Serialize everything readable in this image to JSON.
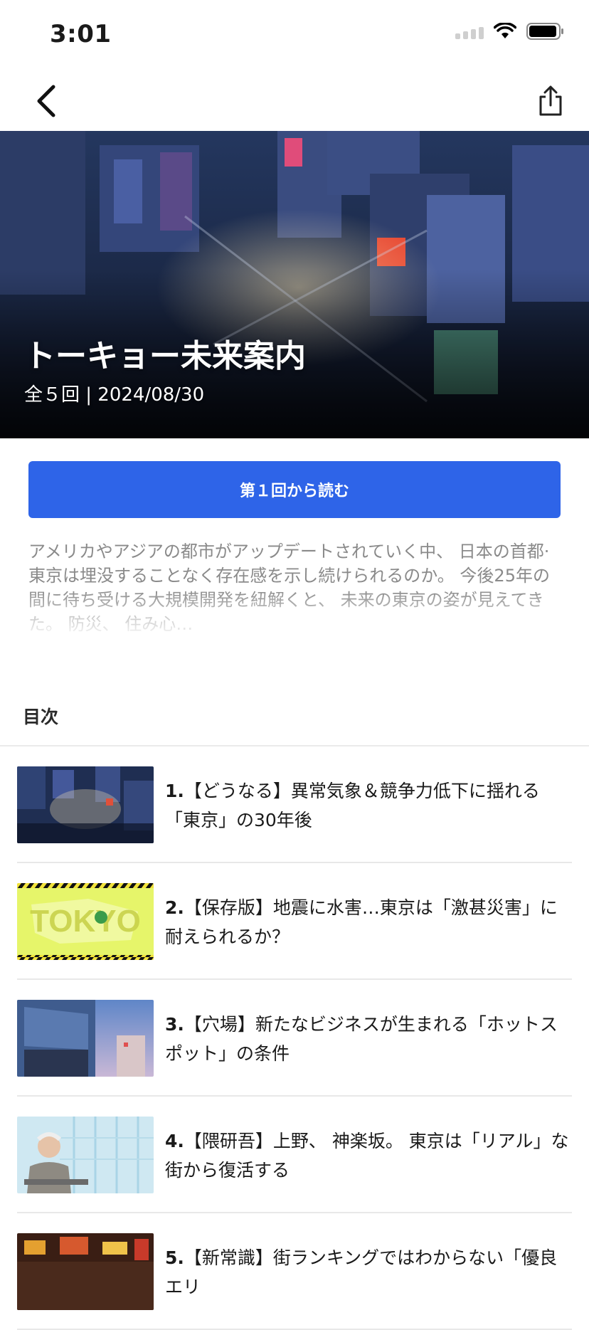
{
  "status_bar": {
    "time": "3:01"
  },
  "hero": {
    "title": "トーキョー未来案内",
    "meta": "全５回 | 2024/08/30"
  },
  "read_button": "第１回から読む",
  "description": "アメリカやアジアの都市がアップデートされていく中、 日本の首都·東京は埋没することなく存在感を示し続けられるのか。 今後25年の間に待ち受ける大規模開発を紐解くと、 未来の東京の姿が見えてきた。 防災、 住み心…",
  "toc": {
    "heading": "目次",
    "items": [
      {
        "num": "1.",
        "title": "【どうなる】異常気象＆競争力低下に揺れる「東京」の30年後"
      },
      {
        "num": "2.",
        "title": "【保存版】地震に水害…東京は「激甚災害」に耐えられるか？"
      },
      {
        "num": "3.",
        "title": "【穴場】新たなビジネスが生まれる「ホットスポット」の条件"
      },
      {
        "num": "4.",
        "title": "【隈研吾】上野、 神楽坂。 東京は「リアル」な街から復活する"
      },
      {
        "num": "5.",
        "title": "【新常識】街ランキングではわからない「優良エリ"
      }
    ],
    "thumb2_text": "TOKYO"
  },
  "colors": {
    "accent": "#2e64e8",
    "thumb2_bg": "#e6f56a"
  }
}
